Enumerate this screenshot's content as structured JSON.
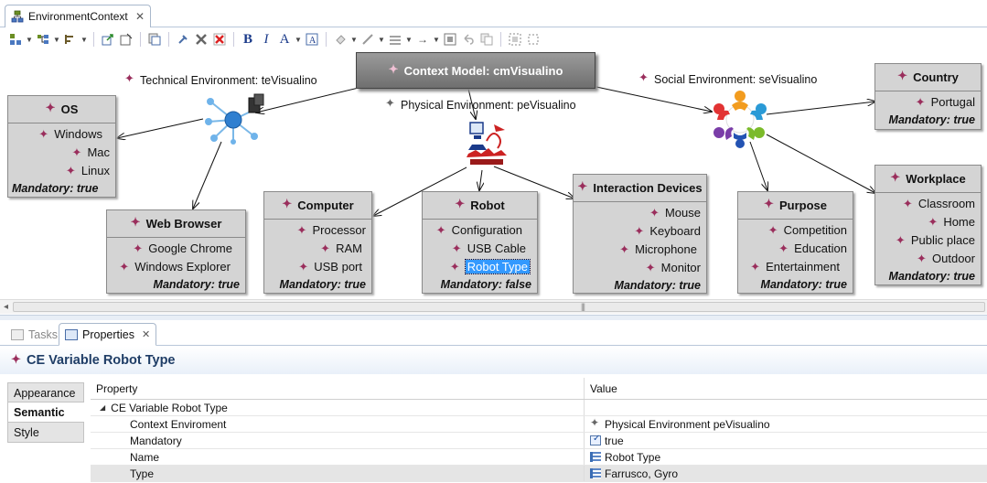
{
  "editor": {
    "tab_label": "EnvironmentContext"
  },
  "toolbar": {
    "buttons": [
      "select-tool",
      "arrange",
      "align",
      "export",
      "properties",
      "delete-from-diagram",
      "delete-from-model",
      "bold",
      "italic",
      "font-color",
      "fill-color",
      "line-color",
      "line-style",
      "arrow-style",
      "auto-size",
      "undo",
      "copy-format",
      "zoom"
    ],
    "bold_label": "B",
    "italic_label": "I",
    "font_label": "A"
  },
  "diagram": {
    "root": "Context Model: cmVisualino",
    "environments": {
      "technical": "Technical Environment: teVisualino",
      "physical": "Physical Environment: peVisualino",
      "social": "Social Environment: seVisualino"
    },
    "nodes": {
      "os": {
        "title": "OS",
        "items": [
          "Windows",
          "Mac",
          "Linux"
        ],
        "mandatory": "Mandatory: true"
      },
      "browser": {
        "title": "Web Browser",
        "items": [
          "Google Chrome",
          "Windows Explorer"
        ],
        "mandatory": "Mandatory: true"
      },
      "computer": {
        "title": "Computer",
        "items": [
          "Processor",
          "RAM",
          "USB port"
        ],
        "mandatory": "Mandatory: true"
      },
      "robot": {
        "title": "Robot",
        "items": [
          "Configuration",
          "USB Cable",
          "Robot Type"
        ],
        "mandatory": "Mandatory: false"
      },
      "interaction": {
        "title": "Interaction Devices",
        "items": [
          "Mouse",
          "Keyboard",
          "Microphone",
          "Monitor"
        ],
        "mandatory": "Mandatory: true"
      },
      "purpose": {
        "title": "Purpose",
        "items": [
          "Competition",
          "Education",
          "Entertainment"
        ],
        "mandatory": "Mandatory: true"
      },
      "country": {
        "title": "Country",
        "items": [
          "Portugal"
        ],
        "mandatory": "Mandatory: true"
      },
      "workplace": {
        "title": "Workplace",
        "items": [
          "Classroom",
          "Home",
          "Public place",
          "Outdoor"
        ],
        "mandatory": "Mandatory: true"
      }
    },
    "colors": {
      "node_fill": "#d4d4d4",
      "root_fill": "#7f7f7f",
      "bullet": "#9a2e5c",
      "selection": "#3399ff"
    }
  },
  "properties_panel": {
    "tabs": {
      "tasks": "Tasks",
      "properties": "Properties"
    },
    "header": "CE Variable Robot Type",
    "side_tabs": [
      "Appearance",
      "Semantic",
      "Style"
    ],
    "active_side_tab": "Semantic",
    "columns": {
      "property": "Property",
      "value": "Value"
    },
    "group_label": "CE Variable Robot Type",
    "rows": [
      {
        "property": "Context Enviroment",
        "value": "Physical Environment peVisualino"
      },
      {
        "property": "Mandatory",
        "value": "true"
      },
      {
        "property": "Name",
        "value": "Robot Type"
      },
      {
        "property": "Type",
        "value": "Farrusco, Gyro"
      }
    ]
  }
}
